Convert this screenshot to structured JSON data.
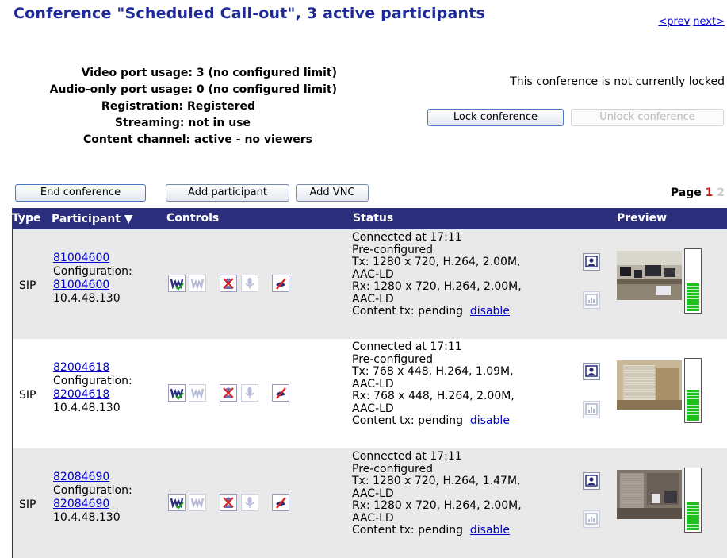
{
  "header": {
    "title": "Conference \"Scheduled Call-out\", 3 active participants",
    "prev_label": "<prev",
    "next_label": "next>"
  },
  "info": {
    "video_port_label": "Video port usage:",
    "video_port_value": "3 (no configured limit)",
    "audio_port_label": "Audio-only port usage:",
    "audio_port_value": "0 (no configured limit)",
    "registration_label": "Registration:",
    "registration_value": "Registered",
    "streaming_label": "Streaming:",
    "streaming_value": "not in use",
    "content_label": "Content channel:",
    "content_value": "active - no viewers"
  },
  "lock": {
    "status_text": "This conference is not currently locked",
    "lock_label": "Lock conference",
    "unlock_label": "Unlock conference"
  },
  "actions": {
    "end_label": "End conference",
    "add_participant_label": "Add participant",
    "add_vnc_label": "Add VNC"
  },
  "pagination": {
    "label": "Page",
    "current": "1",
    "other": "2"
  },
  "table": {
    "headers": {
      "type": "Type",
      "participant": "Participant",
      "controls": "Controls",
      "status": "Status",
      "preview": "Preview"
    },
    "rows": [
      {
        "type": "SIP",
        "name": "81004600",
        "config_label": "Configuration:",
        "config_link": "81004600",
        "ip": "10.4.48.130",
        "connected": "Connected at 17:11",
        "preconf": "Pre-configured",
        "tx1": "Tx: 1280 x 720, H.264, 2.00M,",
        "tx2": "AAC-LD",
        "rx1": "Rx: 1280 x 720, H.264, 2.00M,",
        "rx2": "AAC-LD",
        "content": "Content tx: pending",
        "disable": "disable",
        "meter_level": 0.45
      },
      {
        "type": "SIP",
        "name": "82004618",
        "config_label": "Configuration:",
        "config_link": "82004618",
        "ip": "10.4.48.130",
        "connected": "Connected at 17:11",
        "preconf": "Pre-configured",
        "tx1": "Tx: 768 x 448, H.264, 1.09M,",
        "tx2": "AAC-LD",
        "rx1": "Rx: 768 x 448, H.264, 2.00M,",
        "rx2": "AAC-LD",
        "content": "Content tx: pending",
        "disable": "disable",
        "meter_level": 0.5
      },
      {
        "type": "SIP",
        "name": "82084690",
        "config_label": "Configuration:",
        "config_link": "82084690",
        "ip": "10.4.48.130",
        "connected": "Connected at 17:11",
        "preconf": "Pre-configured",
        "tx1": "Tx: 1280 x 720, H.264, 1.47M,",
        "tx2": "AAC-LD",
        "rx1": "Rx: 1280 x 720, H.264, 2.00M,",
        "rx2": "AAC-LD",
        "content": "Content tx: pending",
        "disable": "disable",
        "meter_level": 0.45
      }
    ]
  },
  "colors": {
    "title": "#1f2a9a",
    "header_bg": "#2a2e7c",
    "page_current": "#d01818",
    "meter_green": "#1fbf1f"
  },
  "icons": {
    "video_on": "video-participant-check-icon",
    "video_off": "video-participant-dim-icon",
    "mute_video": "mute-video-icon",
    "mic": "microphone-icon",
    "content": "content-disable-icon",
    "layout": "layout-icon",
    "stats": "statistics-icon"
  }
}
